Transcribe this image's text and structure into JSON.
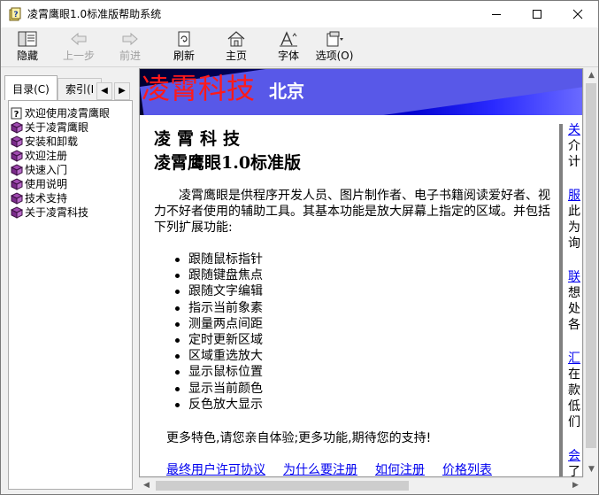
{
  "window": {
    "title": "凌霄鹰眼1.0标准版帮助系统",
    "icon": "help-book-icon",
    "controls": [
      "minimize-icon",
      "maximize-icon",
      "close-icon"
    ]
  },
  "toolbar": {
    "hide": "隐藏",
    "back": "上一步",
    "forward": "前进",
    "refresh": "刷新",
    "home": "主页",
    "font": "字体",
    "options": "选项(O)"
  },
  "tabs": {
    "contents": "目录(C)",
    "index": "索引(I"
  },
  "tree": {
    "items": [
      {
        "label": "欢迎使用凌霄鹰眼",
        "icon": "help-page-icon"
      },
      {
        "label": "关于凌霄鹰眼",
        "icon": "book-icon"
      },
      {
        "label": "安装和卸载",
        "icon": "book-icon"
      },
      {
        "label": "欢迎注册",
        "icon": "book-icon"
      },
      {
        "label": "快速入门",
        "icon": "book-icon"
      },
      {
        "label": "使用说明",
        "icon": "book-icon"
      },
      {
        "label": "技术支持",
        "icon": "book-icon"
      },
      {
        "label": "关于凌霄科技",
        "icon": "book-icon"
      }
    ]
  },
  "banner": {
    "main": "凌霄科技",
    "sub": "北京"
  },
  "content": {
    "company": "凌霄科技",
    "product": "凌霄鹰眼1.0标准版",
    "intro": "凌霄鹰眼是供程序开发人员、图片制作者、电子书籍阅读爱好者、视力不好者使用的辅助工具。其基本功能是放大屏幕上指定的区域。并包括下列扩展功能:",
    "features": [
      "跟随鼠标指针",
      "跟随键盘焦点",
      "跟随文字编辑",
      "指示当前象素",
      "测量两点间距",
      "定时更新区域",
      "区域重选放大",
      "显示鼠标位置",
      "显示当前颜色",
      "反色放大显示"
    ],
    "more": "更多特色,请您亲自体验;更多功能,期待您的支持!",
    "links": [
      "最终用户许可协议",
      "为什么要注册",
      "如何注册",
      "价格列表"
    ]
  },
  "right_column": {
    "blocks": [
      {
        "link": "关",
        "text": [
          "介",
          "计"
        ]
      },
      {
        "link": "服",
        "text": [
          "此",
          "为",
          "询"
        ]
      },
      {
        "link": "联",
        "text": [
          "想",
          "处",
          "各"
        ]
      },
      {
        "link": "汇",
        "text": [
          "在",
          "款",
          "低",
          "们"
        ]
      },
      {
        "link": "会",
        "text": [
          "了"
        ]
      }
    ]
  },
  "colors": {
    "banner_text": "#ff1a1a",
    "link": "#0000ee",
    "banner_dark": "#000030",
    "banner_light": "#6a6aff"
  }
}
